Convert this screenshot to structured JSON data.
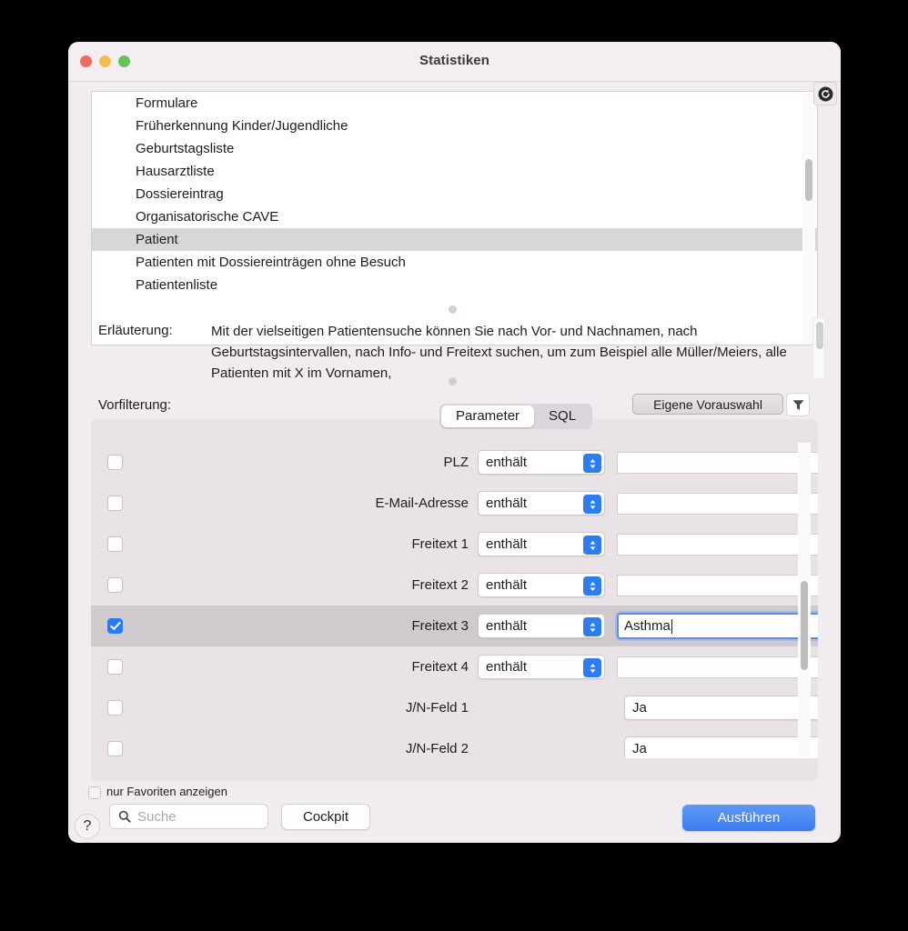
{
  "window": {
    "title": "Statistiken",
    "traffic_lights": [
      "close-red",
      "minimize-yellow",
      "maximize-green"
    ],
    "colors": {
      "red": "#ED6A5E",
      "yellow": "#F4BD4F",
      "green": "#61C454",
      "accent_blue": "#2D7DF1",
      "window_bg": "#F1ECF0",
      "selection_grey": "#D7D7D7"
    }
  },
  "toolbar": {
    "refresh_icon": "refresh-icon"
  },
  "stat_list": {
    "items": [
      {
        "label": "Formulare",
        "selected": false
      },
      {
        "label": "Früherkennung Kinder/Jugendliche",
        "selected": false
      },
      {
        "label": "Geburtstagsliste",
        "selected": false
      },
      {
        "label": "Hausarztliste",
        "selected": false
      },
      {
        "label": "Dossiereintrag",
        "selected": false
      },
      {
        "label": "Organisatorische CAVE",
        "selected": false
      },
      {
        "label": "Patient",
        "selected": true
      },
      {
        "label": "Patienten mit Dossiereinträgen ohne Besuch",
        "selected": false
      },
      {
        "label": "Patientenliste",
        "selected": false
      }
    ]
  },
  "explanation": {
    "label": "Erläuterung:",
    "text": "Mit der vielseitigen Patientensuche können Sie nach Vor- und Nachnamen, nach Geburtstagsintervallen, nach Info- und Freitext suchen, um zum Beispiel alle Müller/Meiers, alle Patienten mit X im Vornamen,"
  },
  "prefilter": {
    "label": "Vorfilterung:",
    "selected_value": "Eigene Vorauswahl",
    "filter_icon": "funnel-icon"
  },
  "tabs": [
    {
      "label": "Parameter",
      "active": true
    },
    {
      "label": "SQL",
      "active": false
    }
  ],
  "parameters": {
    "rows": [
      {
        "checked": false,
        "label": "PLZ",
        "control": "text",
        "operator": "enthält",
        "value": "",
        "highlighted": false,
        "focused": false
      },
      {
        "checked": false,
        "label": "E-Mail-Adresse",
        "control": "text",
        "operator": "enthält",
        "value": "",
        "highlighted": false,
        "focused": false
      },
      {
        "checked": false,
        "label": "Freitext 1",
        "control": "text",
        "operator": "enthält",
        "value": "",
        "highlighted": false,
        "focused": false
      },
      {
        "checked": false,
        "label": "Freitext 2",
        "control": "text",
        "operator": "enthält",
        "value": "",
        "highlighted": false,
        "focused": false
      },
      {
        "checked": true,
        "label": "Freitext 3",
        "control": "text",
        "operator": "enthält",
        "value": "Asthma",
        "highlighted": true,
        "focused": true
      },
      {
        "checked": false,
        "label": "Freitext 4",
        "control": "text",
        "operator": "enthält",
        "value": "",
        "highlighted": false,
        "focused": false
      },
      {
        "checked": false,
        "label": "J/N-Feld 1",
        "control": "select",
        "operator": "",
        "value": "Ja",
        "highlighted": false,
        "focused": false
      },
      {
        "checked": false,
        "label": "J/N-Feld 2",
        "control": "select",
        "operator": "",
        "value": "Ja",
        "highlighted": false,
        "focused": false
      }
    ]
  },
  "footer": {
    "favorites_label": "nur Favoriten anzeigen",
    "favorites_checked": false,
    "help_label": "?",
    "search_placeholder": "Suche",
    "search_value": "",
    "search_icon": "search-icon",
    "cockpit_label": "Cockpit",
    "run_label": "Ausführen"
  }
}
